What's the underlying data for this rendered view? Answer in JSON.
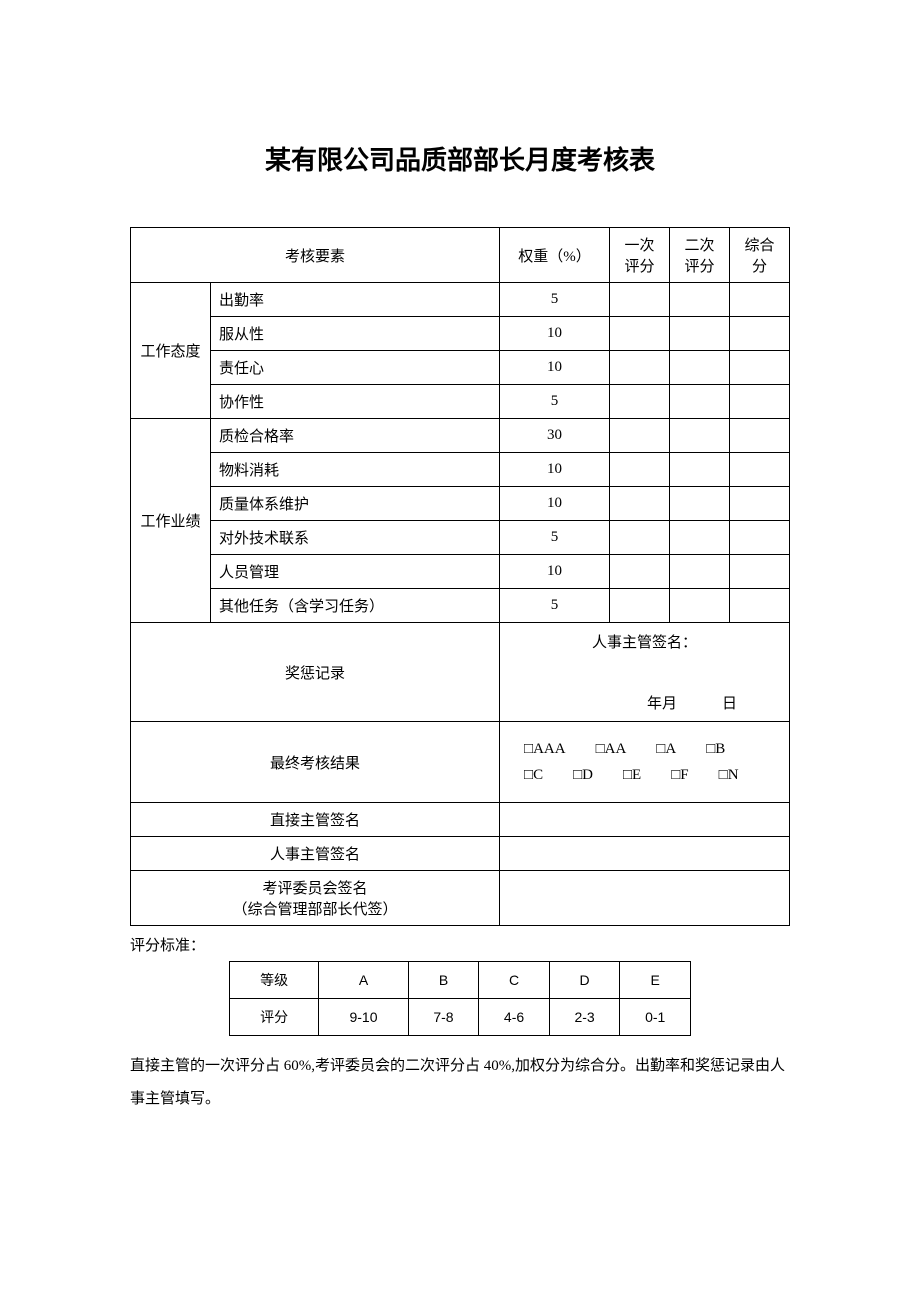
{
  "title": "某有限公司品质部部长月度考核表",
  "headers": {
    "element": "考核要素",
    "weight": "权重（%）",
    "score1": "一次评分",
    "score2": "二次评分",
    "total": "综合分"
  },
  "sections": [
    {
      "name": "工作态度",
      "items": [
        {
          "label": "出勤率",
          "weight": "5"
        },
        {
          "label": "服从性",
          "weight": "10"
        },
        {
          "label": "责任心",
          "weight": "10"
        },
        {
          "label": "协作性",
          "weight": "5"
        }
      ]
    },
    {
      "name": "工作业绩",
      "items": [
        {
          "label": "质检合格率",
          "weight": "30"
        },
        {
          "label": "物料消耗",
          "weight": "10"
        },
        {
          "label": "质量体系维护",
          "weight": "10"
        },
        {
          "label": "对外技术联系",
          "weight": "5"
        },
        {
          "label": "人员管理",
          "weight": "10"
        },
        {
          "label": "其他任务（含学习任务）",
          "weight": "5"
        }
      ]
    }
  ],
  "record": {
    "label": "奖惩记录",
    "sig_label": "人事主管签名：",
    "date_label": "年月　　　日"
  },
  "final_result": {
    "label": "最终考核结果",
    "options": [
      "AAA",
      "AA",
      "A",
      "B",
      "C",
      "D",
      "E",
      "F",
      "N"
    ]
  },
  "signatures": {
    "direct": "直接主管签名",
    "hr": "人事主管签名",
    "committee": "考评委员会签名",
    "committee_sub": "（综合管理部部长代签）"
  },
  "standard": {
    "title": "评分标准：",
    "grade_label": "等级",
    "score_label": "评分",
    "grades": [
      "A",
      "B",
      "C",
      "D",
      "E"
    ],
    "ranges": [
      "9-10",
      "7-8",
      "4-6",
      "2-3",
      "0-1"
    ]
  },
  "footnote": "直接主管的一次评分占 60%,考评委员会的二次评分占 40%,加权分为综合分。出勤率和奖惩记录由人事主管填写。"
}
